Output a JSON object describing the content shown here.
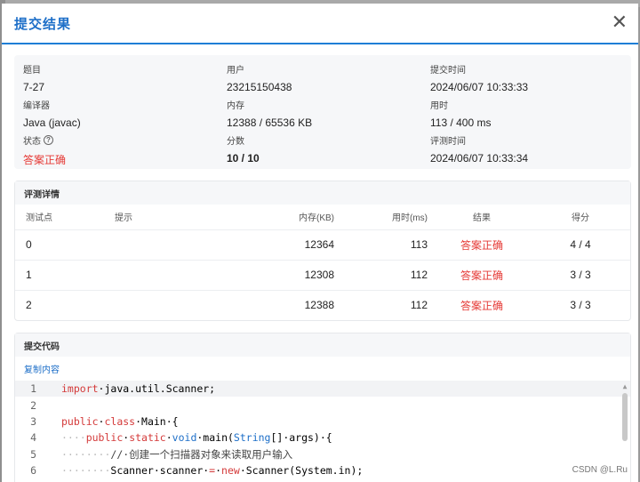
{
  "dialog": {
    "title": "提交结果",
    "close": "✕"
  },
  "info": {
    "problem_label": "题目",
    "problem_value": "7-27",
    "user_label": "用户",
    "user_value": "23215150438",
    "submit_time_label": "提交时间",
    "submit_time_value": "2024/06/07 10:33:33",
    "compiler_label": "编译器",
    "compiler_value": "Java (javac)",
    "memory_label": "内存",
    "memory_value": "12388 / 65536 KB",
    "time_label": "用时",
    "time_value": "113 / 400 ms",
    "status_label": "状态",
    "status_value": "答案正确",
    "score_label": "分数",
    "score_value": "10 / 10",
    "judge_time_label": "评测时间",
    "judge_time_value": "2024/06/07 10:33:34",
    "help_icon": "?"
  },
  "judge": {
    "title": "评测详情",
    "headers": {
      "point": "测试点",
      "hint": "提示",
      "memory": "内存(KB)",
      "time": "用时(ms)",
      "result": "结果",
      "score": "得分"
    },
    "rows": [
      {
        "point": "0",
        "hint": "",
        "memory": "12364",
        "time": "113",
        "result": "答案正确",
        "score": "4 / 4"
      },
      {
        "point": "1",
        "hint": "",
        "memory": "12308",
        "time": "112",
        "result": "答案正确",
        "score": "3 / 3"
      },
      {
        "point": "2",
        "hint": "",
        "memory": "12388",
        "time": "112",
        "result": "答案正确",
        "score": "3 / 3"
      }
    ]
  },
  "code": {
    "title": "提交代码",
    "copy_label": "复制内容",
    "lines": [
      {
        "n": "1",
        "t1": "import",
        "t2": "·java.util.Scanner;"
      },
      {
        "n": "2"
      },
      {
        "n": "3",
        "t1": "public",
        "t2": "·",
        "t3": "class",
        "t4": "·Main·{"
      },
      {
        "n": "4",
        "t1": "····",
        "t2": "public",
        "t3": "·",
        "t4": "static",
        "t5": "·",
        "t6": "void",
        "t7": "·main(",
        "t8": "String",
        "t9": "[]·args)·{"
      },
      {
        "n": "5",
        "t1": "········",
        "t2": "//·创建一个扫描器对象来读取用户输入"
      },
      {
        "n": "6",
        "t1": "········",
        "t2": "Scanner·scanner·",
        "t3": "=",
        "t4": "·",
        "t5": "new",
        "t6": "·Scanner(System.in);"
      }
    ]
  },
  "watermark": "CSDN @L.Ru",
  "colors": {
    "accent": "#1e6fc8",
    "success_red": "#e53935"
  }
}
